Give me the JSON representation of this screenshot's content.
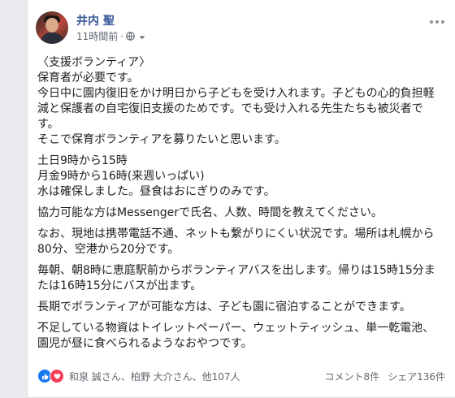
{
  "post": {
    "author": "井内 聖",
    "timestamp": "11時間前",
    "separator": "·",
    "paragraphs": [
      "〈支援ボランティア〉\n保育者が必要です。\n今日中に園内復旧をかけ明日から子どもを受け入れます。子どもの心的負担軽減と保護者の自宅復旧支援のためです。でも受け入れる先生たちも被災者です。\nそこで保育ボランティアを募りたいと思います。",
      "土日9時から15時\n月金9時から16時(来週いっぱい)\n水は確保しました。昼食はおにぎりのみです。",
      "協力可能な方はMessengerで氏名、人数、時間を教えてください。",
      "なお、現地は携帯電話不通、ネットも繋がりにくい状況です。場所は札幌から80分、空港から20分です。",
      "毎朝、朝8時に恵庭駅前からボランティアバスを出します。帰りは15時15分または16時15分にバスが出ます。",
      "長期でボランティアが可能な方は、子ども園に宿泊することができます。",
      "不足している物資はトイレットペーパー、ウェットティッシュ、単一乾電池、園児が昼に食べられるようなおやつです。"
    ]
  },
  "footer": {
    "reaction_names": "和泉 誠さん、柏野 大介さん、他107人",
    "comments": "コメント8件",
    "shares": "シェア136件"
  },
  "icons": {
    "avatar": "avatar",
    "privacy": "globe-icon",
    "audience_menu": "caret-down-icon",
    "options": "more-options-icon",
    "reactions": [
      "like-icon",
      "love-icon"
    ]
  },
  "colors": {
    "author_link": "#385898",
    "like": "#1877f2",
    "love": "#f33e58",
    "background": "#e9ebee"
  }
}
